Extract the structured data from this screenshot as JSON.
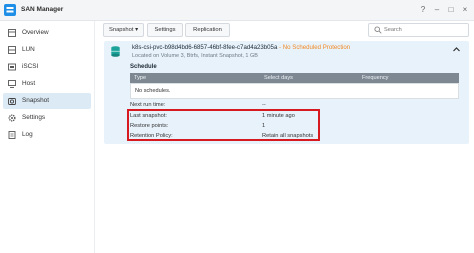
{
  "window": {
    "title": "SAN Manager",
    "controls": [
      "?",
      "–",
      "□",
      "×"
    ]
  },
  "sidebar": {
    "items": [
      {
        "label": "Overview",
        "icon": "overview-icon",
        "active": false
      },
      {
        "label": "LUN",
        "icon": "lun-icon",
        "active": false
      },
      {
        "label": "iSCSI",
        "icon": "iscsi-icon",
        "active": false
      },
      {
        "label": "Host",
        "icon": "host-icon",
        "active": false
      },
      {
        "label": "Snapshot",
        "icon": "snapshot-icon",
        "active": true
      },
      {
        "label": "Settings",
        "icon": "gear-icon",
        "active": false
      },
      {
        "label": "Log",
        "icon": "log-icon",
        "active": false
      }
    ]
  },
  "toolbar": {
    "snapshot_label": "Snapshot ▾",
    "settings_label": "Settings",
    "replication_label": "Replication",
    "search_placeholder": "Search"
  },
  "lun": {
    "name": "k8s-csi-pvc-b98d4bd6-6857-46bf-8fee-c7ad4a23b05a",
    "separator": " - ",
    "status": "No Scheduled Protection",
    "location": "Located on Volume 3, Btrfs, Instant Snapshot, 1 GB"
  },
  "schedule": {
    "title": "Schedule",
    "columns": [
      "Type",
      "Select days",
      "Frequency"
    ],
    "empty_text": "No schedules."
  },
  "details": {
    "next_run_label": "Next run time:",
    "next_run_value": "--",
    "last_snapshot_label": "Last snapshot:",
    "last_snapshot_value": "1 minute ago",
    "restore_points_label": "Restore points:",
    "restore_points_value": "1",
    "retention_label": "Retention Policy:",
    "retention_value": "Retain all snapshots"
  },
  "colors": {
    "accent": "#1f8ee6",
    "warning": "#f08a24",
    "highlight_border": "#d71920",
    "panel_bg": "#e8f2fb"
  }
}
